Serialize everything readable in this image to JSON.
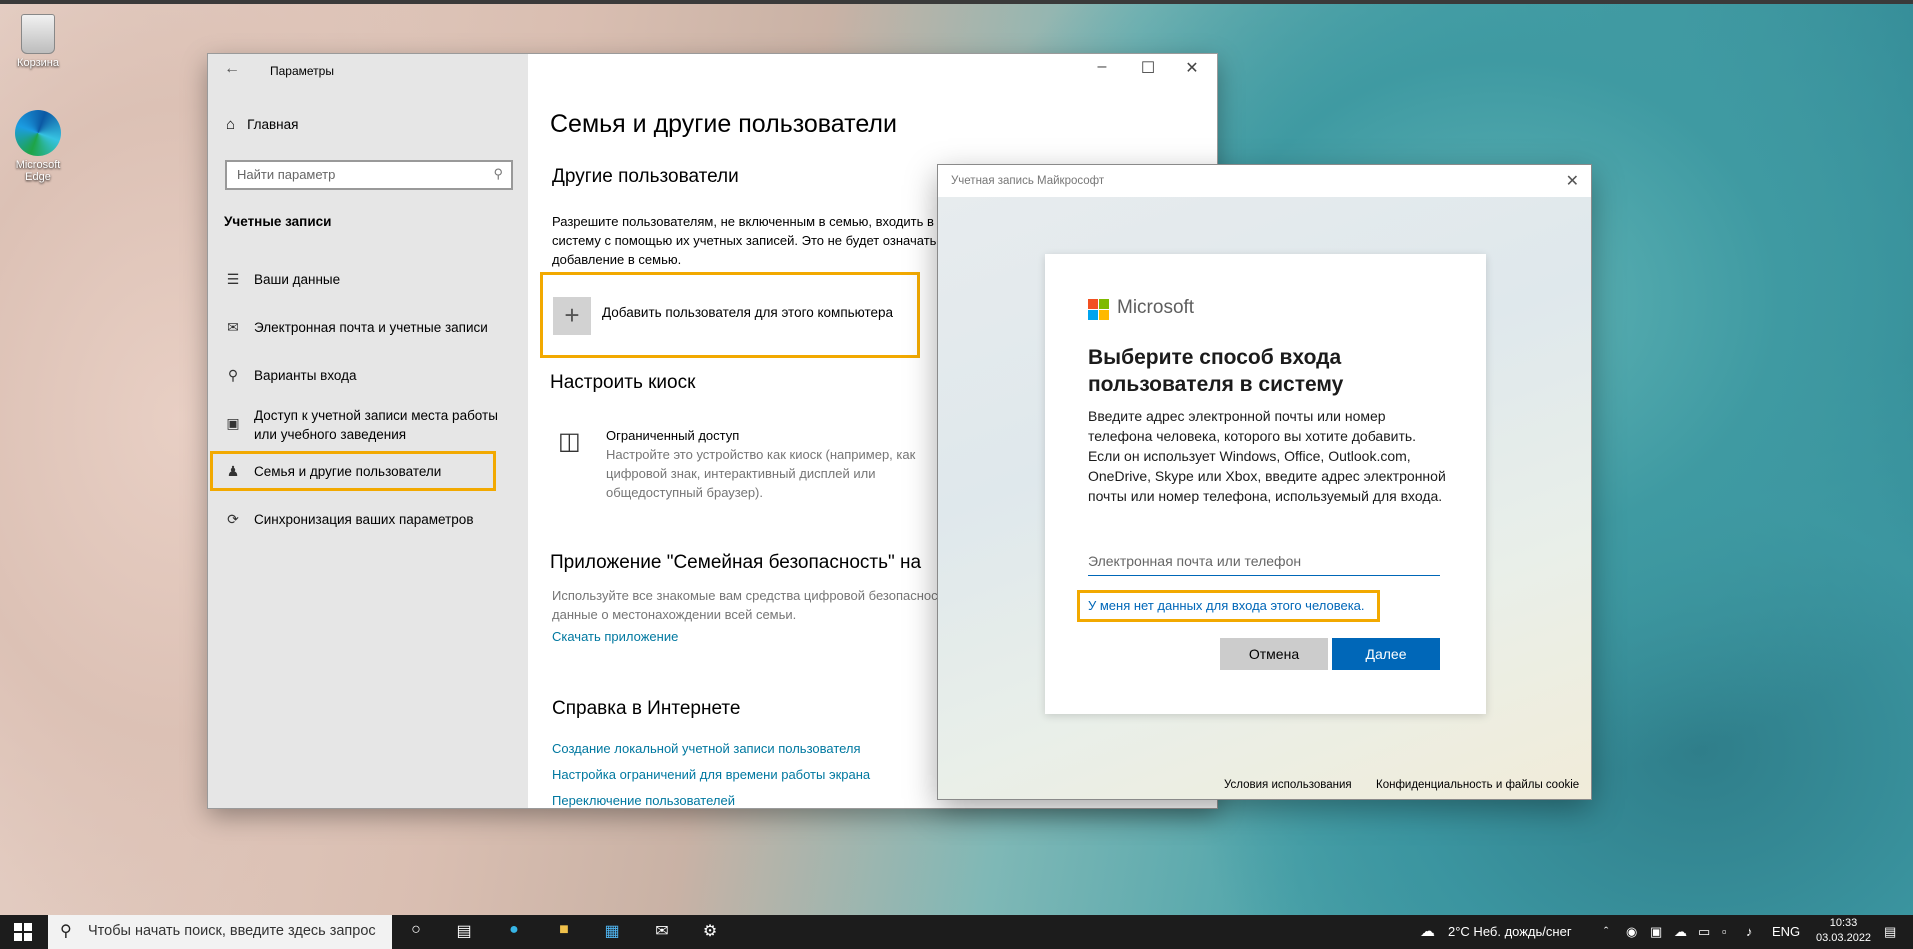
{
  "desktop": {
    "icons": [
      {
        "label": "Корзина"
      },
      {
        "label": "Microsoft Edge"
      }
    ]
  },
  "settings": {
    "title": "Параметры",
    "sidebar": {
      "home": "Главная",
      "search_placeholder": "Найти параметр",
      "section": "Учетные записи",
      "items": [
        {
          "label": "Ваши данные"
        },
        {
          "label": "Электронная почта и учетные записи"
        },
        {
          "label": "Варианты входа"
        },
        {
          "label": "Доступ к учетной записи места работы или учебного заведения"
        },
        {
          "label": "Семья и другие пользователи"
        },
        {
          "label": "Синхронизация ваших параметров"
        }
      ]
    },
    "content": {
      "page_title": "Семья и другие пользователи",
      "other_users_heading": "Другие пользователи",
      "other_users_text": "Разрешите пользователям, не включенным в семью, входить в систему с помощью их учетных записей. Это не будет означать добавление в семью.",
      "add_user_label": "Добавить пользователя для этого компьютера",
      "kiosk_heading": "Настроить киоск",
      "kiosk_title": "Ограниченный доступ",
      "kiosk_text": "Настройте это устройство как киоск (например, как цифровой знак, интерактивный дисплей или общедоступный браузер).",
      "family_app_heading": "Приложение \"Семейная безопасность\" на",
      "family_app_text": "Используйте все знакомые вам средства цифровой безопасности и данные о местонахождении всей семьи.",
      "download_link": "Скачать приложение",
      "help_heading": "Справка в Интернете",
      "help_links": [
        "Создание локальной учетной записи пользователя",
        "Настройка ограничений для времени работы экрана",
        "Переключение пользователей"
      ]
    }
  },
  "ms_dialog": {
    "title": "Учетная запись Майкрософт",
    "brand": "Microsoft",
    "heading": "Выберите способ входа пользователя в систему",
    "description": "Введите адрес электронной почты или номер телефона человека, которого вы хотите добавить. Если он использует Windows, Office, Outlook.com, OneDrive, Skype или Xbox, введите адрес электронной почты или номер телефона, используемый для входа.",
    "input_placeholder": "Электронная почта или телефон",
    "no_data_link": "У меня нет данных для входа этого человека.",
    "cancel": "Отмена",
    "next": "Далее",
    "footer_terms": "Условия использования",
    "footer_privacy": "Конфиденциальность и файлы cookie"
  },
  "taskbar": {
    "search_placeholder": "Чтобы начать поиск, введите здесь запрос",
    "weather": "2°C  Неб. дождь/снег",
    "language": "ENG",
    "time": "10:33",
    "date": "03.03.2022"
  },
  "colors": {
    "highlight": "#f2a900",
    "accent": "#0067b8",
    "link": "#0078a0"
  }
}
